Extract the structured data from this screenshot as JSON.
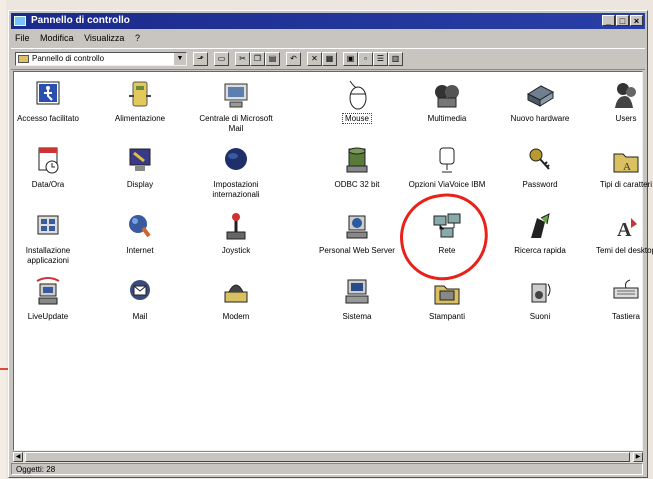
{
  "window": {
    "title": "Pannello di controllo"
  },
  "menu": {
    "items": [
      "File",
      "Modifica",
      "Visualizza",
      "?"
    ]
  },
  "address": {
    "value": "Pannello di controllo"
  },
  "toolbar": {
    "buttons": [
      "up-folder",
      "map-drive",
      "cut",
      "copy",
      "paste",
      "undo",
      "delete",
      "properties",
      "large-icons",
      "small-icons",
      "list",
      "details"
    ]
  },
  "items": [
    {
      "label": "Accesso facilitato",
      "icon": "accessibility-icon"
    },
    {
      "label": "Alimentazione",
      "icon": "power-icon"
    },
    {
      "label": "Centrale di Microsoft Mail",
      "icon": "mail-postoffice-icon"
    },
    {
      "label": "Mouse",
      "icon": "mouse-icon"
    },
    {
      "label": "Multimedia",
      "icon": "multimedia-icon"
    },
    {
      "label": "Nuovo hardware",
      "icon": "new-hardware-icon"
    },
    {
      "label": "Users",
      "icon": "users-icon"
    },
    {
      "label": "Data/Ora",
      "icon": "date-time-icon"
    },
    {
      "label": "Display",
      "icon": "display-icon"
    },
    {
      "label": "Impostazioni internazionali",
      "icon": "globe-icon"
    },
    {
      "label": "ODBC 32 bit",
      "icon": "odbc-icon"
    },
    {
      "label": "Opzioni ViaVoice IBM",
      "icon": "viavoice-icon"
    },
    {
      "label": "Password",
      "icon": "keys-icon"
    },
    {
      "label": "Tipi di caratteri",
      "icon": "fonts-folder-icon"
    },
    {
      "label": "Installazione applicazioni",
      "icon": "add-remove-programs-icon"
    },
    {
      "label": "Internet",
      "icon": "internet-icon"
    },
    {
      "label": "Joystick",
      "icon": "joystick-icon"
    },
    {
      "label": "Personal Web Server",
      "icon": "web-server-icon"
    },
    {
      "label": "Rete",
      "icon": "network-icon"
    },
    {
      "label": "Ricerca rapida",
      "icon": "find-fast-icon"
    },
    {
      "label": "Temi del desktop",
      "icon": "desktop-themes-icon"
    },
    {
      "label": "LiveUpdate",
      "icon": "liveupdate-icon"
    },
    {
      "label": "Mail",
      "icon": "mail-icon"
    },
    {
      "label": "Modem",
      "icon": "modem-icon"
    },
    {
      "label": "Sistema",
      "icon": "system-icon"
    },
    {
      "label": "Stampanti",
      "icon": "printers-icon"
    },
    {
      "label": "Suoni",
      "icon": "sounds-icon"
    },
    {
      "label": "Tastiera",
      "icon": "keyboard-icon"
    }
  ],
  "status": {
    "text": "Oggetti: 28"
  },
  "colors": {
    "titlebar": "#1a2a8a",
    "highlight_circle": "#e8211a"
  }
}
